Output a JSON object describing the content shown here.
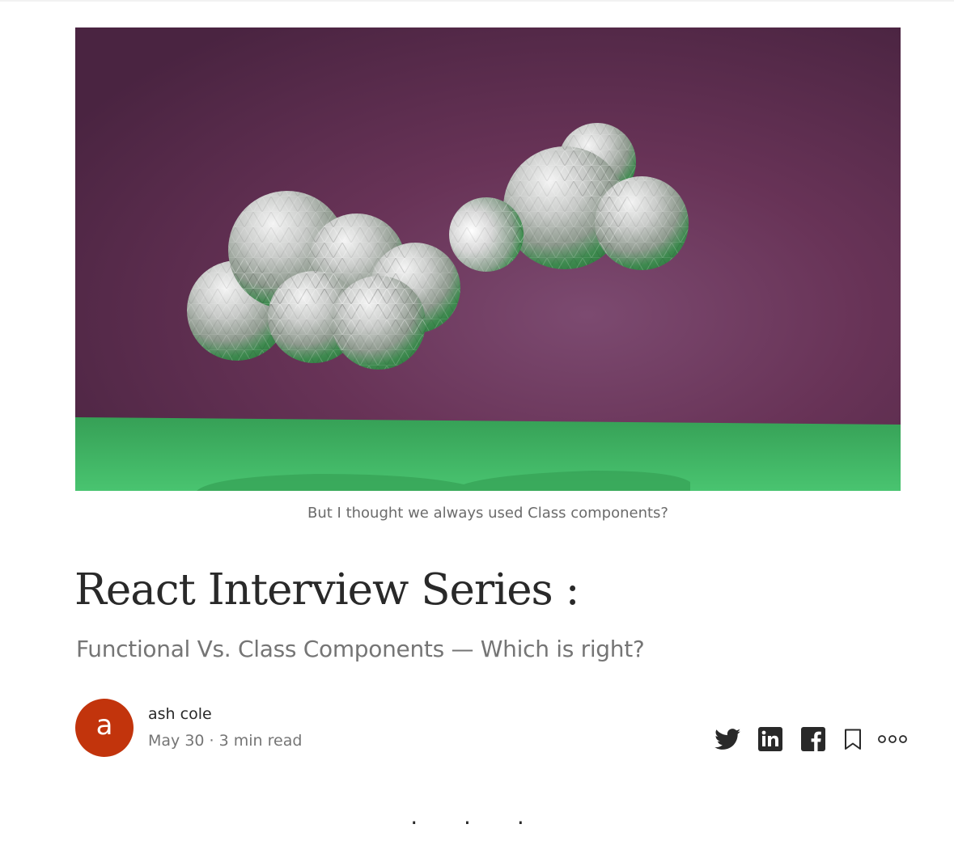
{
  "article": {
    "caption": "But I thought we always used Class components?",
    "title": "React Interview Series :",
    "subtitle": "Functional Vs. Class Components — Which is right?",
    "section_separator": "· · ·"
  },
  "author": {
    "initial": "a",
    "name": "ash cole",
    "meta": "May 30 · 3 min read",
    "avatar_color": "#c2340c"
  },
  "share_actions": [
    {
      "icon": "twitter-icon"
    },
    {
      "icon": "linkedin-icon"
    },
    {
      "icon": "facebook-icon"
    },
    {
      "icon": "bookmark-icon"
    },
    {
      "icon": "more-options-icon"
    }
  ],
  "colors": {
    "hero_background": "#6e3458",
    "hero_ground": "#3aa35a",
    "text_primary": "#292929",
    "text_secondary": "#757575"
  }
}
